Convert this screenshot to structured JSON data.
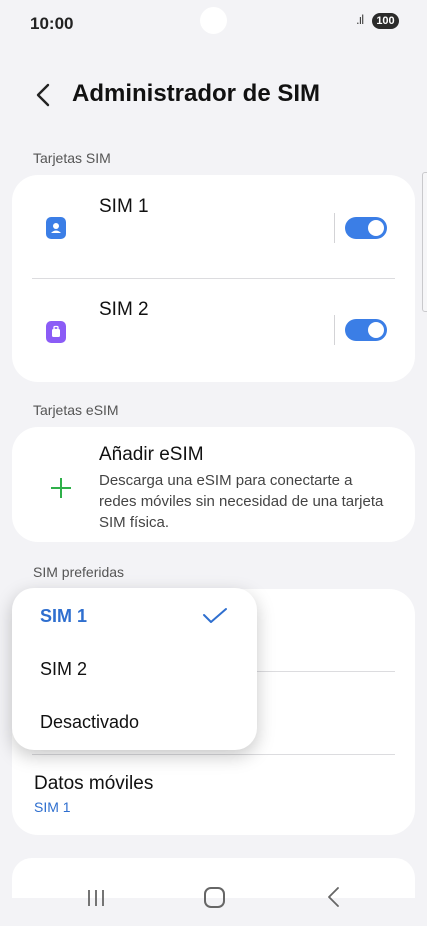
{
  "status": {
    "time": "10:00",
    "battery": "100",
    "signal": ".ıl"
  },
  "header": {
    "title": "Administrador de SIM"
  },
  "sections": {
    "sim_cards": "Tarjetas SIM",
    "esim": "Tarjetas eSIM",
    "preferred": "SIM preferidas"
  },
  "sims": [
    {
      "label": "SIM 1",
      "enabled": true,
      "color": "#3b7ee6"
    },
    {
      "label": "SIM 2",
      "enabled": true,
      "color": "#8b5cf6"
    }
  ],
  "esim": {
    "title": "Añadir eSIM",
    "description": "Descarga una eSIM para conectarte a redes móviles sin necesidad de una tarjeta SIM física."
  },
  "preferred": {
    "mobile_data": {
      "label": "Datos móviles",
      "value": "SIM 1"
    }
  },
  "dropdown": {
    "options": [
      "SIM 1",
      "SIM 2",
      "Desactivado"
    ],
    "selected": "SIM 1"
  },
  "colors": {
    "accent": "#2f6fcf",
    "add_icon": "#2fb04a",
    "toggle": "#3b7ee6"
  }
}
